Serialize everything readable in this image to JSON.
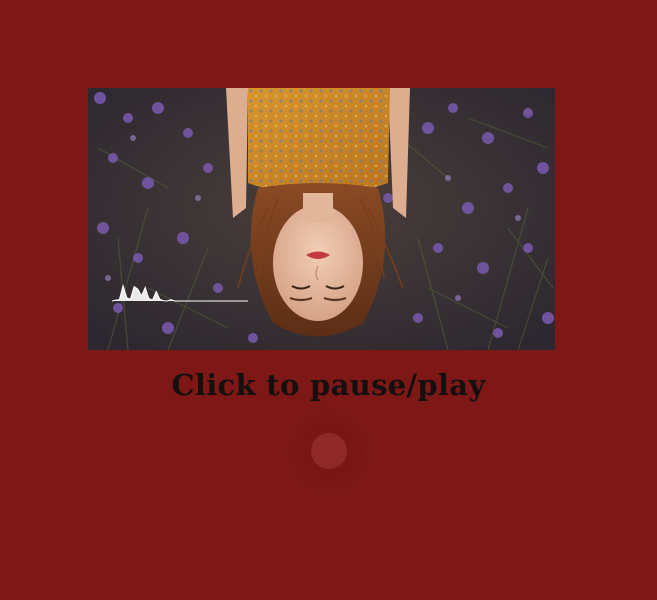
{
  "player": {
    "caption": "Click to pause/play",
    "state": "playing",
    "visualizer_levels": [
      0.0,
      0.05,
      0.08,
      0.9,
      0.2,
      0.1,
      0.85,
      0.7,
      0.3,
      0.8,
      0.15,
      0.05,
      0.55,
      0.1,
      0.02,
      0.0,
      0.08,
      0.0,
      0.0,
      0.0
    ]
  },
  "colors": {
    "background": "#7d1817",
    "caption": "#141010",
    "visualizer": "#ffffff",
    "toggle": "#8f2a28"
  }
}
